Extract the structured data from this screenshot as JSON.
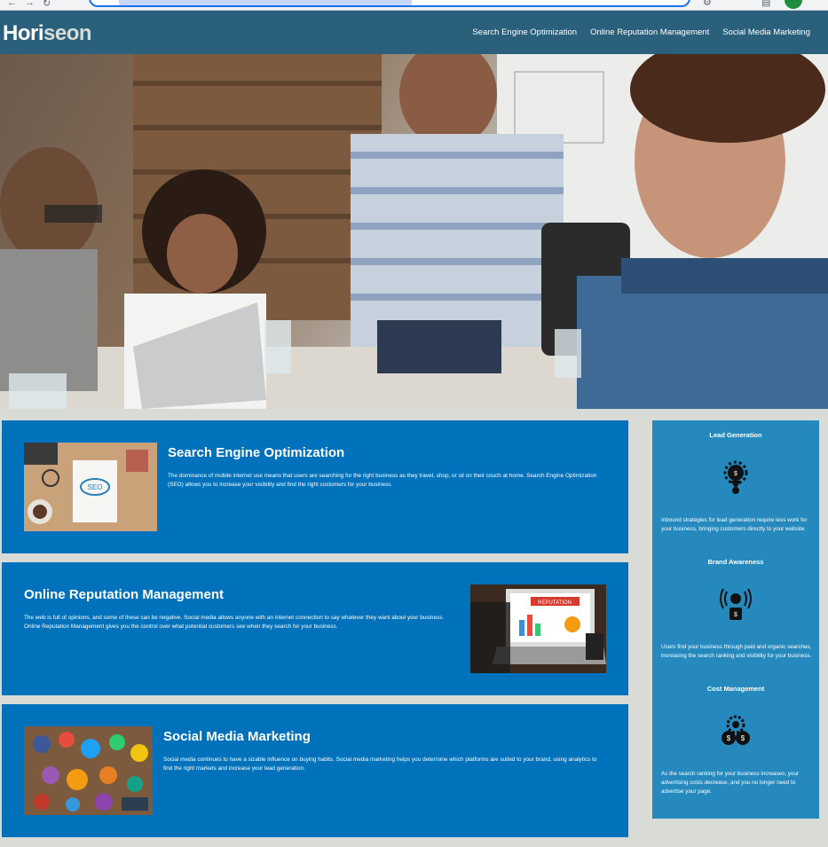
{
  "header": {
    "logo_main": "Hori",
    "logo_accent": "seon",
    "nav": [
      {
        "label": "Search Engine Optimization"
      },
      {
        "label": "Online Reputation Management"
      },
      {
        "label": "Social Media Marketing"
      }
    ]
  },
  "hero": {
    "image": "team-meeting-photo"
  },
  "content": [
    {
      "title": "Search Engine Optimization",
      "text": "The dominance of mobile internet use means that users are searching for the right business as they travel, shop, or sit on their couch at home. Search Engine Optimization (SEO) allows you to increase your visibility and find the right customers for your business.",
      "image": "seo-notebook-photo"
    },
    {
      "title": "Online Reputation Management",
      "text": "The web is full of opinions, and some of these can be negative. Social media allows anyone with an internet connection to say whatever they want about your business. Online Reputation Management gives you the control over what potential customers see when they search for your business.",
      "image": "reputation-laptop-photo"
    },
    {
      "title": "Social Media Marketing",
      "text": "Social media continues to have a sizable influence on buying habits. Social media marketing helps you determine which platforms are suited to your brand, using analytics to find the right markets and increase your lead generation.",
      "image": "social-media-icons-photo"
    }
  ],
  "benefits": [
    {
      "title": "Lead Generation",
      "icon": "lead-generation-icon",
      "text": "Inbound strategies for lead generation require less work for your business, bringing customers directly to your website."
    },
    {
      "title": "Brand Awareness",
      "icon": "brand-awareness-icon",
      "text": "Users find your business through paid and organic searches, increasing the search ranking and visibility for your business."
    },
    {
      "title": "Cost Management",
      "icon": "cost-management-icon",
      "text": "As the search ranking for your business increases, your advertising costs decrease, and you no longer need to advertise your page."
    }
  ],
  "colors": {
    "header_bg": "#2a607c",
    "card_bg": "#0072bb",
    "benefits_bg": "#2589bd",
    "page_bg": "#d9dcd6"
  }
}
